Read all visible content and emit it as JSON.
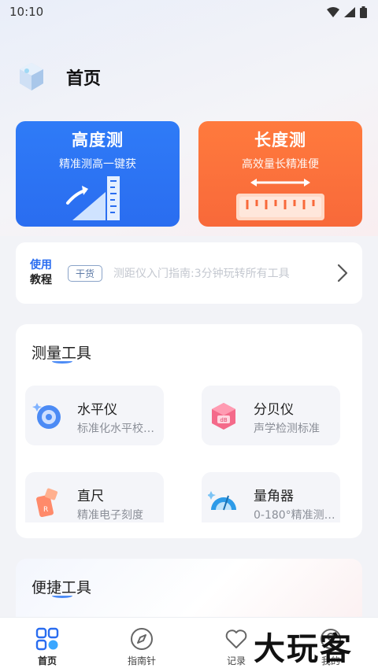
{
  "status_bar": {
    "time": "10:10"
  },
  "header": {
    "title": "首页"
  },
  "feature_cards": [
    {
      "title": "高度测",
      "subtitle": "精准测高一键获",
      "color": "#2a6df0"
    },
    {
      "title": "长度测",
      "subtitle": "高效量长精准便",
      "color": "#f8693a"
    }
  ],
  "tutorial": {
    "label_line1": "使用",
    "label_line2": "教程",
    "badge": "干货",
    "text": "测距仪入门指南:3分钟玩转所有工具"
  },
  "measure_tools": {
    "title": "测量工具",
    "items": [
      {
        "name": "水平仪",
        "desc": "标准化水平校…",
        "icon": "level-icon"
      },
      {
        "name": "分贝仪",
        "desc": "声学检测标准",
        "icon": "decibel-icon"
      },
      {
        "name": "直尺",
        "desc": "精准电子刻度",
        "icon": "ruler-icon"
      },
      {
        "name": "量角器",
        "desc": "0-180°精准测…",
        "icon": "protractor-icon"
      }
    ]
  },
  "quick_tools": {
    "title": "便捷工具"
  },
  "tabbar": {
    "items": [
      {
        "label": "首页",
        "icon": "home-grid-icon",
        "active": true
      },
      {
        "label": "指南针",
        "icon": "compass-icon",
        "active": false
      },
      {
        "label": "记录",
        "icon": "heart-icon",
        "active": false
      },
      {
        "label": "我的",
        "icon": "profile-icon",
        "active": false
      }
    ]
  },
  "watermark": {
    "text": "大玩客"
  },
  "colors": {
    "accent_blue": "#2a6df0",
    "accent_orange": "#f8693a"
  }
}
